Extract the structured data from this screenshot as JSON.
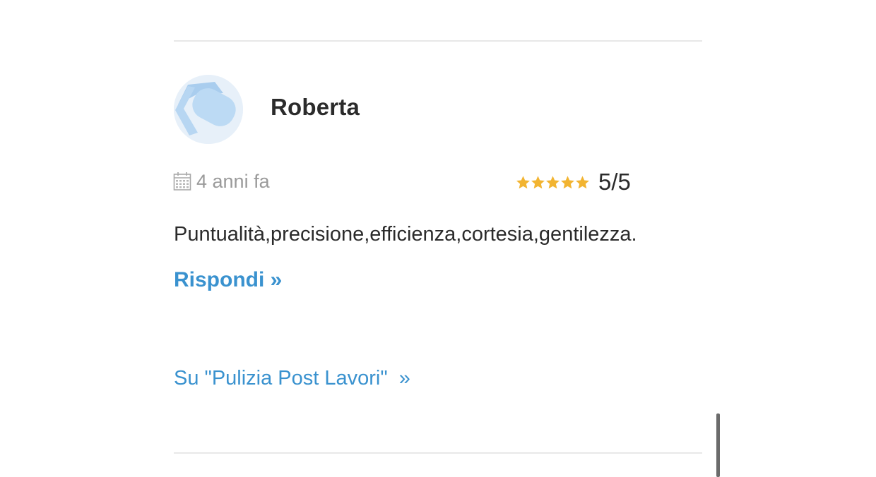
{
  "review": {
    "reviewer_name": "Roberta",
    "date": "4 anni fa",
    "rating": {
      "stars_filled": 5,
      "stars_total": 5,
      "label": "5/5",
      "star_color": "#f2b431"
    },
    "text": "Puntualità,precisione,efficienza,cortesia,gentilezza.",
    "reply_link": "Rispondi »",
    "service_link": "Su \"Pulizia Post Lavori\"  »"
  },
  "colors": {
    "link": "#3a92cf",
    "text": "#2b2b2b",
    "muted": "#9a9a9a",
    "divider": "#e8e8e8"
  },
  "icons": {
    "date": "calendar-icon",
    "rating": "star-icon",
    "avatar": "default-user-avatar"
  }
}
